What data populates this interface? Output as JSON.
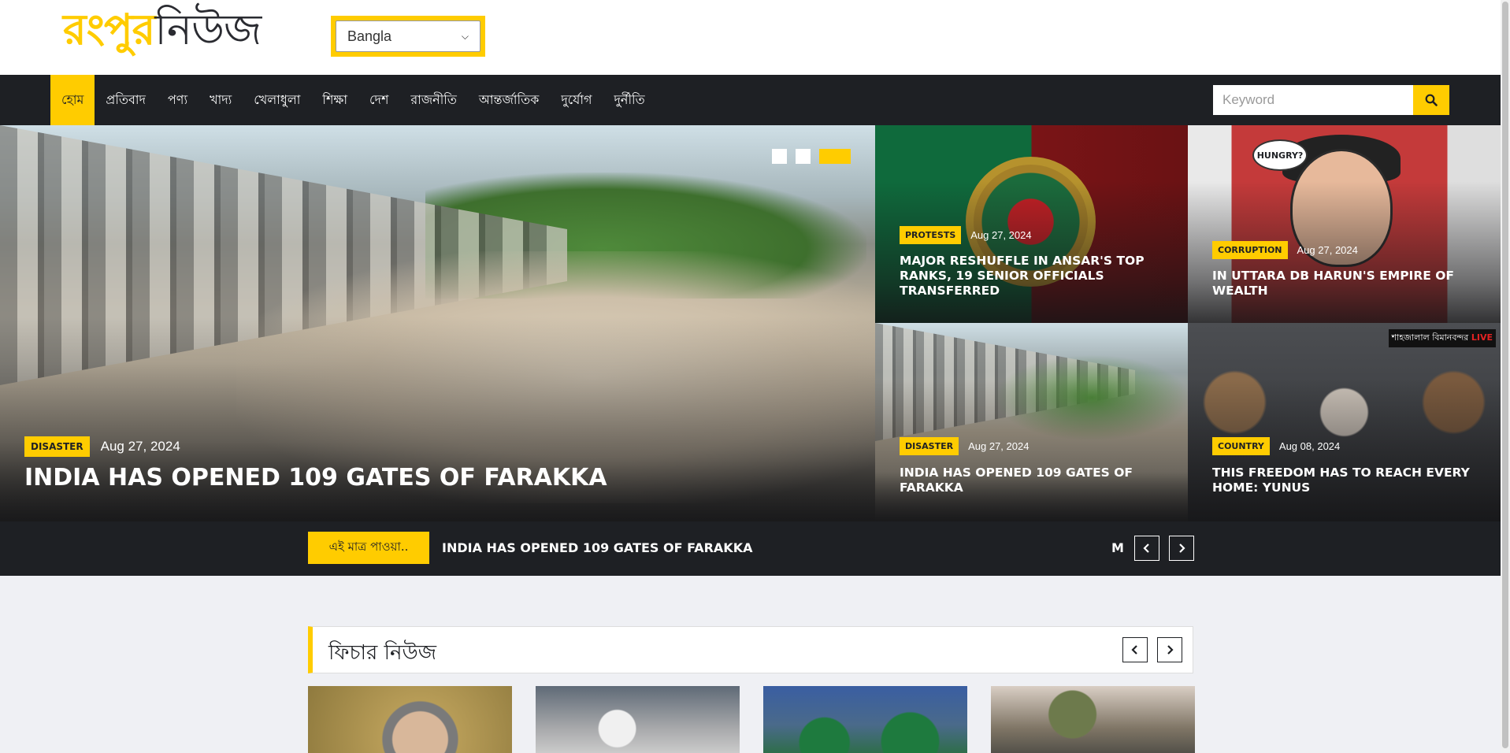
{
  "header": {
    "logo_part1": "রংপুর",
    "logo_part2": "নিউজ",
    "language_select": "Bangla"
  },
  "nav": {
    "items": [
      "হোম",
      "প্রতিবাদ",
      "পণ্য",
      "খাদ্য",
      "খেলাধুলা",
      "শিক্ষা",
      "দেশ",
      "রাজনীতি",
      "আন্তর্জাতিক",
      "দুর্যোগ",
      "দুর্নীতি"
    ],
    "active": "হোম",
    "search_placeholder": "Keyword"
  },
  "hero": {
    "category": "DISASTER",
    "date": "Aug 27, 2024",
    "title": "INDIA HAS OPENED 109 GATES OF FARAKKA",
    "slider_dots": 3,
    "active_dot": 3
  },
  "tiles": [
    {
      "category": "PROTESTS",
      "date": "Aug 27, 2024",
      "title": "MAJOR RESHUFFLE IN ANSAR'S TOP RANKS, 19 SENIOR OFFICIALS TRANSFERRED"
    },
    {
      "category": "CORRUPTION",
      "date": "Aug 27, 2024",
      "title": "IN UTTARA DB HARUN'S EMPIRE OF WEALTH",
      "image_text": "HUNGRY?"
    },
    {
      "category": "DISASTER",
      "date": "Aug 27, 2024",
      "title": "INDIA HAS OPENED 109 GATES OF FARAKKA"
    },
    {
      "category": "COUNTRY",
      "date": "Aug 08, 2024",
      "title": "THIS FREEDOM HAS TO REACH EVERY HOME: YUNUS",
      "image_text": "শাহজালাল বিমানবন্দর",
      "live": "LIVE"
    }
  ],
  "ticker": {
    "label": "এই মাত্র পাওয়া..",
    "text": "INDIA HAS OPENED 109 GATES OF FARAKKA",
    "next_fragment": "M"
  },
  "featured": {
    "title": "ফিচার নিউজ",
    "cards": 4
  },
  "colors": {
    "accent": "#ffcc00",
    "dark": "#1e2024",
    "background": "#eff0f4"
  }
}
